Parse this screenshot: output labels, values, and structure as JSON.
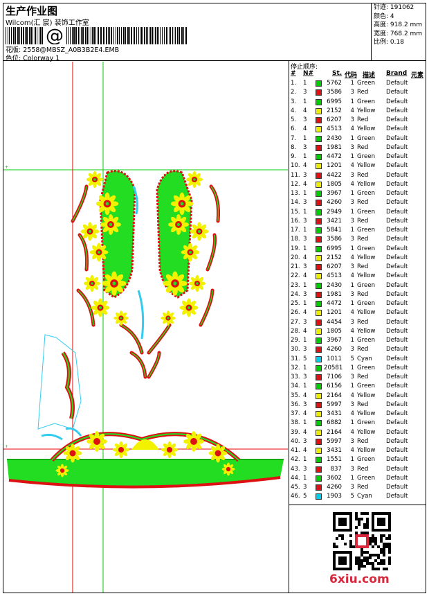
{
  "header": {
    "title": "生产作业图",
    "company": "Wilcom(汇 宸) 装饰工作室",
    "barcode_char": "@",
    "filename_label": "花版:",
    "filename": "2558@MBSZ_A0B3B2E4.EMB",
    "colorway_label": "色位:",
    "colorway": "Colorway 1"
  },
  "meta": {
    "stitches_label": "针迹:",
    "stitches": "191062",
    "colors_label": "颜色:",
    "colors": "4",
    "height_label": "高度:",
    "height": "918.2 mm",
    "width_label": "宽度:",
    "width": "768.2 mm",
    "scale_label": "比例:",
    "scale": "0.18"
  },
  "stop_sequence": {
    "title": "停止顺序:",
    "headers": [
      "#",
      "N#",
      "St.",
      "代码",
      "描述",
      "Brand",
      "元素"
    ],
    "swatch_colors": {
      "1": "#00cc00",
      "3": "#dd1111",
      "4": "#eeee00",
      "5": "#00ccee"
    },
    "rows": [
      {
        "i": "1.",
        "n": "1",
        "st": "5762",
        "code": "1",
        "desc": "Green",
        "brand": "Default"
      },
      {
        "i": "2.",
        "n": "3",
        "st": "3586",
        "code": "3",
        "desc": "Red",
        "brand": "Default"
      },
      {
        "i": "3.",
        "n": "1",
        "st": "6995",
        "code": "1",
        "desc": "Green",
        "brand": "Default"
      },
      {
        "i": "4.",
        "n": "4",
        "st": "2152",
        "code": "4",
        "desc": "Yellow",
        "brand": "Default"
      },
      {
        "i": "5.",
        "n": "3",
        "st": "6207",
        "code": "3",
        "desc": "Red",
        "brand": "Default"
      },
      {
        "i": "6.",
        "n": "4",
        "st": "4513",
        "code": "4",
        "desc": "Yellow",
        "brand": "Default"
      },
      {
        "i": "7.",
        "n": "1",
        "st": "2430",
        "code": "1",
        "desc": "Green",
        "brand": "Default"
      },
      {
        "i": "8.",
        "n": "3",
        "st": "1981",
        "code": "3",
        "desc": "Red",
        "brand": "Default"
      },
      {
        "i": "9.",
        "n": "1",
        "st": "4472",
        "code": "1",
        "desc": "Green",
        "brand": "Default"
      },
      {
        "i": "10.",
        "n": "4",
        "st": "1201",
        "code": "4",
        "desc": "Yellow",
        "brand": "Default"
      },
      {
        "i": "11.",
        "n": "3",
        "st": "4422",
        "code": "3",
        "desc": "Red",
        "brand": "Default"
      },
      {
        "i": "12.",
        "n": "4",
        "st": "1805",
        "code": "4",
        "desc": "Yellow",
        "brand": "Default"
      },
      {
        "i": "13.",
        "n": "1",
        "st": "3967",
        "code": "1",
        "desc": "Green",
        "brand": "Default"
      },
      {
        "i": "14.",
        "n": "3",
        "st": "4260",
        "code": "3",
        "desc": "Red",
        "brand": "Default"
      },
      {
        "i": "15.",
        "n": "1",
        "st": "2949",
        "code": "1",
        "desc": "Green",
        "brand": "Default"
      },
      {
        "i": "16.",
        "n": "3",
        "st": "3421",
        "code": "3",
        "desc": "Red",
        "brand": "Default"
      },
      {
        "i": "17.",
        "n": "1",
        "st": "5841",
        "code": "1",
        "desc": "Green",
        "brand": "Default"
      },
      {
        "i": "18.",
        "n": "3",
        "st": "3586",
        "code": "3",
        "desc": "Red",
        "brand": "Default"
      },
      {
        "i": "19.",
        "n": "1",
        "st": "6995",
        "code": "1",
        "desc": "Green",
        "brand": "Default"
      },
      {
        "i": "20.",
        "n": "4",
        "st": "2152",
        "code": "4",
        "desc": "Yellow",
        "brand": "Default"
      },
      {
        "i": "21.",
        "n": "3",
        "st": "6207",
        "code": "3",
        "desc": "Red",
        "brand": "Default"
      },
      {
        "i": "22.",
        "n": "4",
        "st": "4513",
        "code": "4",
        "desc": "Yellow",
        "brand": "Default"
      },
      {
        "i": "23.",
        "n": "1",
        "st": "2430",
        "code": "1",
        "desc": "Green",
        "brand": "Default"
      },
      {
        "i": "24.",
        "n": "3",
        "st": "1981",
        "code": "3",
        "desc": "Red",
        "brand": "Default"
      },
      {
        "i": "25.",
        "n": "1",
        "st": "4472",
        "code": "1",
        "desc": "Green",
        "brand": "Default"
      },
      {
        "i": "26.",
        "n": "4",
        "st": "1201",
        "code": "4",
        "desc": "Yellow",
        "brand": "Default"
      },
      {
        "i": "27.",
        "n": "3",
        "st": "4454",
        "code": "3",
        "desc": "Red",
        "brand": "Default"
      },
      {
        "i": "28.",
        "n": "4",
        "st": "1805",
        "code": "4",
        "desc": "Yellow",
        "brand": "Default"
      },
      {
        "i": "29.",
        "n": "1",
        "st": "3967",
        "code": "1",
        "desc": "Green",
        "brand": "Default"
      },
      {
        "i": "30.",
        "n": "3",
        "st": "4260",
        "code": "3",
        "desc": "Red",
        "brand": "Default"
      },
      {
        "i": "31.",
        "n": "5",
        "st": "1011",
        "code": "5",
        "desc": "Cyan",
        "brand": "Default"
      },
      {
        "i": "32.",
        "n": "1",
        "st": "20581",
        "code": "1",
        "desc": "Green",
        "brand": "Default"
      },
      {
        "i": "33.",
        "n": "3",
        "st": "7106",
        "code": "3",
        "desc": "Red",
        "brand": "Default"
      },
      {
        "i": "34.",
        "n": "1",
        "st": "6156",
        "code": "1",
        "desc": "Green",
        "brand": "Default"
      },
      {
        "i": "35.",
        "n": "4",
        "st": "2164",
        "code": "4",
        "desc": "Yellow",
        "brand": "Default"
      },
      {
        "i": "36.",
        "n": "3",
        "st": "5997",
        "code": "3",
        "desc": "Red",
        "brand": "Default"
      },
      {
        "i": "37.",
        "n": "4",
        "st": "3431",
        "code": "4",
        "desc": "Yellow",
        "brand": "Default"
      },
      {
        "i": "38.",
        "n": "1",
        "st": "6882",
        "code": "1",
        "desc": "Green",
        "brand": "Default"
      },
      {
        "i": "39.",
        "n": "4",
        "st": "2164",
        "code": "4",
        "desc": "Yellow",
        "brand": "Default"
      },
      {
        "i": "40.",
        "n": "3",
        "st": "5997",
        "code": "3",
        "desc": "Red",
        "brand": "Default"
      },
      {
        "i": "41.",
        "n": "4",
        "st": "3431",
        "code": "4",
        "desc": "Yellow",
        "brand": "Default"
      },
      {
        "i": "42.",
        "n": "1",
        "st": "1551",
        "code": "1",
        "desc": "Green",
        "brand": "Default"
      },
      {
        "i": "43.",
        "n": "3",
        "st": "837",
        "code": "3",
        "desc": "Red",
        "brand": "Default"
      },
      {
        "i": "44.",
        "n": "1",
        "st": "3602",
        "code": "1",
        "desc": "Green",
        "brand": "Default"
      },
      {
        "i": "45.",
        "n": "3",
        "st": "4260",
        "code": "3",
        "desc": "Red",
        "brand": "Default"
      },
      {
        "i": "46.",
        "n": "5",
        "st": "1903",
        "code": "5",
        "desc": "Cyan",
        "brand": "Default"
      }
    ]
  },
  "footer": {
    "watermark": "6xiu.com"
  },
  "design_colors": {
    "green": "#22dd22",
    "red": "#dd1111",
    "yellow": "#f2f200",
    "cyan": "#33ccee",
    "guide_green": "#00cc00",
    "guide_red": "#ee0000"
  }
}
